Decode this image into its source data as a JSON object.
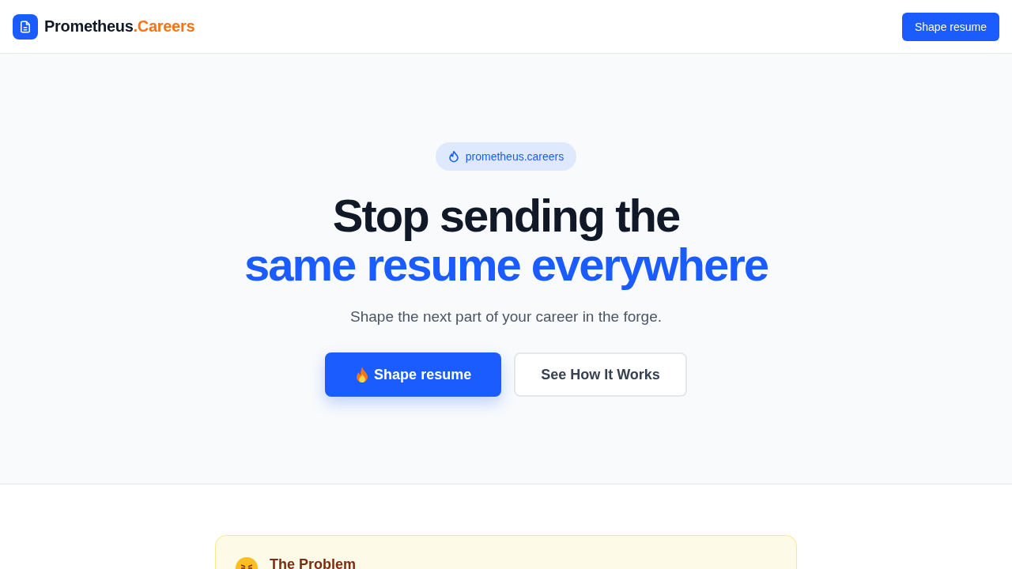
{
  "header": {
    "brand": "Prometheus",
    "brand_suffix": ".Careers",
    "cta": "Shape resume"
  },
  "hero": {
    "badge": "prometheus.careers",
    "title_line_1": "Stop sending the",
    "title_line_2": "same resume everywhere",
    "subtitle": "Shape the next part of your career in the forge.",
    "buttons": [
      {
        "label": "Shape resume",
        "kind": "primary"
      },
      {
        "label": "See How It Works",
        "kind": "secondary"
      }
    ]
  },
  "problem": {
    "title": "The Problem"
  }
}
